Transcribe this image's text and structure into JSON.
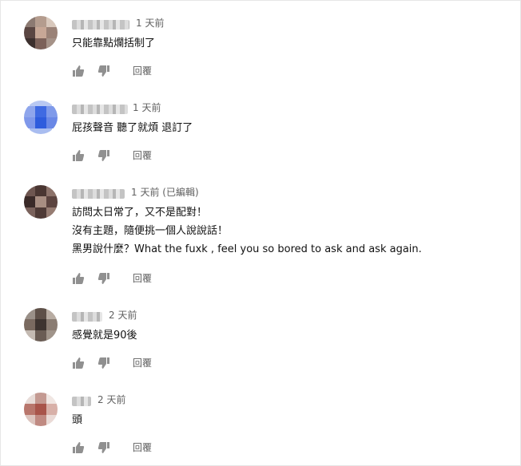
{
  "comments": [
    {
      "time": "1 天前",
      "lines": [
        "只能靠點爛括制了"
      ],
      "reply_label": "回覆"
    },
    {
      "time": "1 天前",
      "lines": [
        "屁孩聲音  聽了就煩  退訂了"
      ],
      "reply_label": "回覆"
    },
    {
      "time": "1 天前 (已編輯)",
      "lines": [
        "訪問太日常了，又不是配對！",
        "沒有主題，隨便挑一個人說說話！",
        "黑男說什麼？What the fuxk , feel you so  bored to ask and ask again."
      ],
      "reply_label": "回覆"
    },
    {
      "time": "2 天前",
      "lines": [
        "感覺就是90後"
      ],
      "reply_label": "回覆"
    },
    {
      "time": "2 天前",
      "lines": [
        "頭"
      ],
      "reply_label": "回覆"
    }
  ],
  "icons": {
    "like": "thumbs-up-icon",
    "dislike": "thumbs-down-icon"
  },
  "colors": {
    "meta": "#606060",
    "text": "#111111",
    "icon": "#909090"
  }
}
